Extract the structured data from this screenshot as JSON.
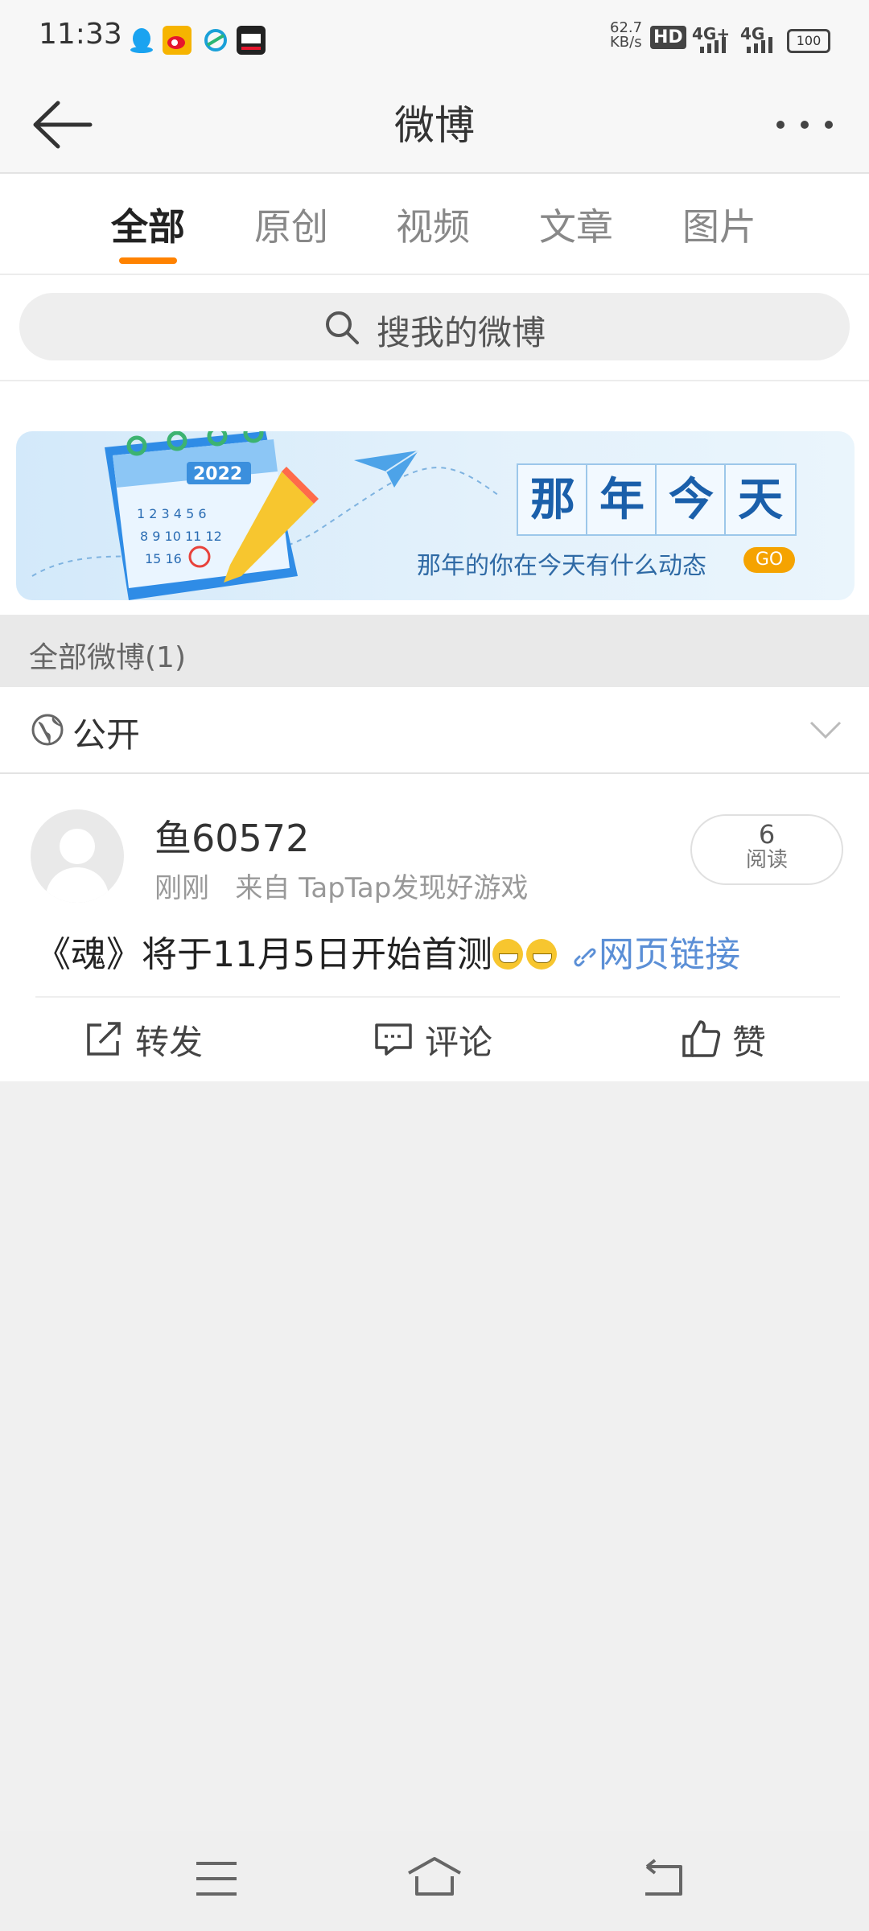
{
  "status_bar": {
    "time": "11:33",
    "speed": "62.7",
    "speed_unit": "KB/s",
    "hd": "HD",
    "net1": "4G+",
    "net2": "4G",
    "battery": "100"
  },
  "header": {
    "title": "微博"
  },
  "tabs": [
    {
      "label": "全部",
      "active": true
    },
    {
      "label": "原创"
    },
    {
      "label": "视频"
    },
    {
      "label": "文章"
    },
    {
      "label": "图片"
    }
  ],
  "search": {
    "placeholder": "搜我的微博"
  },
  "banner": {
    "year_badge": "2022",
    "title_chars": [
      "那",
      "年",
      "今",
      "天"
    ],
    "subtitle": "那年的你在今天有什么动态",
    "go_label": "GO"
  },
  "section": {
    "title": "全部微博(1)"
  },
  "filter": {
    "label": "公开"
  },
  "post": {
    "username": "鱼60572",
    "meta": "刚刚   来自 TapTap发现好游戏",
    "read_count": "6",
    "read_label": "阅读",
    "text": "《魂》将于11月5日开始首测",
    "link_text": "网页链接",
    "actions": {
      "repost": "转发",
      "comment": "评论",
      "like": "赞"
    }
  },
  "colors": {
    "accent": "#ff8200",
    "link": "#5b8fd6",
    "banner_text": "#1a5faa"
  }
}
